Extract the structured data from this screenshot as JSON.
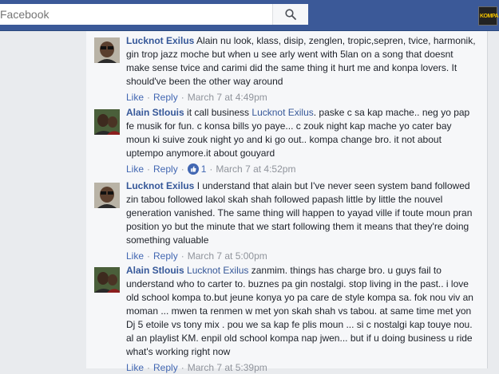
{
  "search": {
    "placeholder": "Facebook"
  },
  "logo": {
    "text": "KOMPA"
  },
  "comments": [
    {
      "author": "Lucknot Exilus",
      "mention": "",
      "text": "Alain nu look, klass, disip, zenglen, tropic,sepren, tvice, harmonik, gin trop jazz moche but when u see arly went with 5lan on a song that doesnt make sense tvice and carimi did the same thing it hurt me and konpa lovers. It should've been the other way around",
      "like": "Like",
      "reply": "Reply",
      "likes": "",
      "time": "March 7 at 4:49pm"
    },
    {
      "author": "Alain Stlouis",
      "mention": "",
      "text": "it call business Lucknot Exilus. paske c sa kap mache.. neg yo pap fe musik for fun. c konsa bills yo paye... c zouk night kap mache yo cater bay moun ki suive zouk night yo and ki go out.. kompa change bro. it not about uptempo anymore.it about gouyard",
      "like": "Like",
      "reply": "Reply",
      "likes": "1",
      "time": "March 7 at 4:52pm"
    },
    {
      "author": "Lucknot Exilus",
      "mention": "",
      "text": "I understand that alain but I've never seen system band followed zin tabou followed lakol skah shah followed papash little by little the nouvel generation vanished. The same thing will happen to yayad ville if toute moun pran position yo but the minute that we start following them it means that they're doing something valuable",
      "like": "Like",
      "reply": "Reply",
      "likes": "",
      "time": "March 7 at 5:00pm"
    },
    {
      "author": "Alain Stlouis",
      "mention": "Lucknot Exilus",
      "text": "zanmim. things has charge bro. u guys fail to understand who to carter to. buznes pa gin nostalgi. stop living in the past.. i love old school kompa to.but jeune konya yo pa care de style kompa sa. fok nou viv an moman ... mwen ta renmen w met yon skah shah vs tabou. at same time met yon Dj 5 etoile vs tony mix . pou we sa kap fe plis moun ... si c nostalgi kap touye nou. al an playlist KM. enpil old school kompa nap jwen... but if u doing business u ride what's working right now",
      "like": "Like",
      "reply": "Reply",
      "likes": "",
      "time": "March 7 at 5:39pm"
    }
  ]
}
